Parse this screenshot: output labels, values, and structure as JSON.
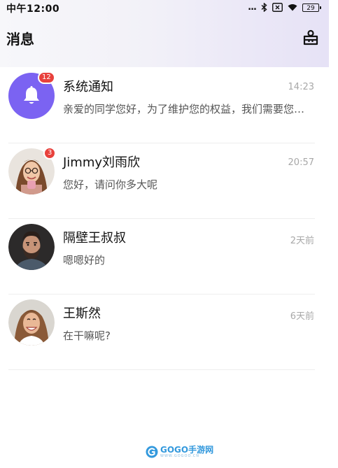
{
  "status_bar": {
    "time": "中午12:00",
    "signal_dots": "...",
    "battery_level": "29"
  },
  "header": {
    "title": "消息",
    "right_icon": "contacts-icon"
  },
  "conversations": [
    {
      "name": "系统通知",
      "message": "亲爱的同学您好，为了维护您的权益，我们需要您完成身份认证",
      "time": "14:23",
      "badge": "12",
      "avatar": "bell-icon",
      "avatar_color": "#7b63f2"
    },
    {
      "name": "Jimmy刘雨欣",
      "message": "您好，请问你多大呢",
      "time": "20:57",
      "badge": "3",
      "avatar": "woman-with-glasses-photo"
    },
    {
      "name": "隔壁王叔叔",
      "message": "嗯嗯好的",
      "time": "2天前",
      "avatar": "bearded-man-photo"
    },
    {
      "name": "王斯然",
      "message": "在干嘛呢?",
      "time": "6天前",
      "avatar": "smiling-woman-photo"
    }
  ],
  "watermark": {
    "text": "GOGO手游网",
    "url": "WWW.GOGOO.CN"
  },
  "colors": {
    "badge": "#e8413c",
    "accent": "#7b63f2",
    "time_text": "#a8a8a8"
  }
}
